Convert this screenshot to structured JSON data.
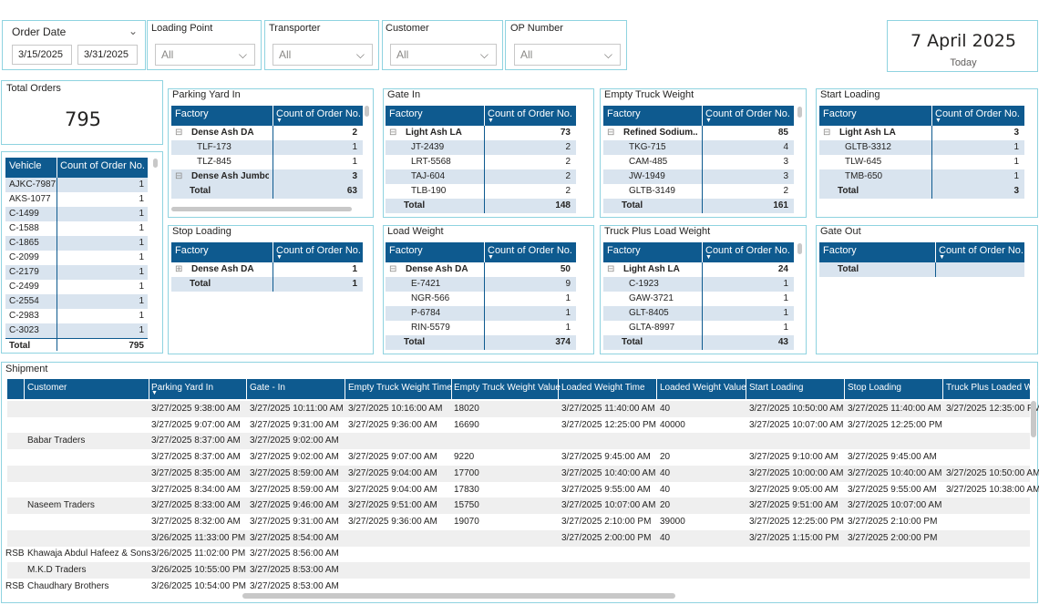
{
  "filters": {
    "order_date": {
      "label": "Order Date",
      "from": "3/15/2025",
      "to": "3/31/2025"
    },
    "loading_point": {
      "label": "Loading Point",
      "value": "All"
    },
    "transporter": {
      "label": "Transporter",
      "value": "All"
    },
    "customer": {
      "label": "Customer",
      "value": "All"
    },
    "op_number": {
      "label": "OP Number",
      "value": "All"
    }
  },
  "today": {
    "date": "7 April 2025",
    "label": "Today"
  },
  "total_orders": {
    "label": "Total Orders",
    "value": "795"
  },
  "vehicle_table": {
    "headers": [
      "Vehicle",
      "Count of Order No."
    ],
    "rows": [
      [
        "AJKC-7987",
        "1"
      ],
      [
        "AKS-1077",
        "1"
      ],
      [
        "C-1499",
        "1"
      ],
      [
        "C-1588",
        "1"
      ],
      [
        "C-1865",
        "1"
      ],
      [
        "C-2099",
        "1"
      ],
      [
        "C-2179",
        "1"
      ],
      [
        "C-2499",
        "1"
      ],
      [
        "C-2554",
        "1"
      ],
      [
        "C-2983",
        "1"
      ],
      [
        "C-3023",
        "1"
      ]
    ],
    "total": [
      "Total",
      "795"
    ]
  },
  "parking_yard": {
    "title": "Parking Yard In",
    "headers": [
      "Factory",
      "Count of Order No."
    ],
    "rows": [
      [
        "⊟",
        "Dense Ash DA",
        "2"
      ],
      [
        "",
        "TLF-173",
        "1"
      ],
      [
        "",
        "TLZ-845",
        "1"
      ],
      [
        "⊟",
        "Dense Ash Jumbo",
        "3"
      ]
    ],
    "total": [
      "Total",
      "63"
    ]
  },
  "gate_in": {
    "title": "Gate In",
    "headers": [
      "Factory",
      "Count of Order No."
    ],
    "rows": [
      [
        "⊟",
        "Light Ash LA",
        "73"
      ],
      [
        "",
        "JT-2439",
        "2"
      ],
      [
        "",
        "LRT-5568",
        "2"
      ],
      [
        "",
        "TAJ-604",
        "2"
      ],
      [
        "",
        "TLB-190",
        "2"
      ]
    ],
    "total": [
      "Total",
      "148"
    ]
  },
  "empty_truck": {
    "title": "Empty Truck Weight",
    "headers": [
      "Factory",
      "Count of Order No."
    ],
    "rows": [
      [
        "⊟",
        "Refined Sodium...",
        "85"
      ],
      [
        "",
        "TKG-715",
        "4"
      ],
      [
        "",
        "CAM-485",
        "3"
      ],
      [
        "",
        "JW-1949",
        "3"
      ],
      [
        "",
        "GLTB-3149",
        "2"
      ]
    ],
    "total": [
      "Total",
      "161"
    ]
  },
  "start_loading": {
    "title": "Start Loading",
    "headers": [
      "Factory",
      "Count of Order No."
    ],
    "rows": [
      [
        "⊟",
        "Light Ash LA",
        "3"
      ],
      [
        "",
        "GLTB-3312",
        "1"
      ],
      [
        "",
        "TLW-645",
        "1"
      ],
      [
        "",
        "TMB-650",
        "1"
      ]
    ],
    "total": [
      "Total",
      "3"
    ]
  },
  "stop_loading": {
    "title": "Stop Loading",
    "headers": [
      "Factory",
      "Count of Order No."
    ],
    "rows": [
      [
        "⊞",
        "Dense Ash DA",
        "1"
      ]
    ],
    "total": [
      "Total",
      "1"
    ]
  },
  "load_weight": {
    "title": "Load Weight",
    "headers": [
      "Factory",
      "Count of Order No."
    ],
    "rows": [
      [
        "⊟",
        "Dense Ash DA",
        "50"
      ],
      [
        "",
        "E-7421",
        "9"
      ],
      [
        "",
        "NGR-566",
        "1"
      ],
      [
        "",
        "P-6784",
        "1"
      ],
      [
        "",
        "RIN-5579",
        "1"
      ]
    ],
    "total": [
      "Total",
      "374"
    ]
  },
  "truck_plus": {
    "title": "Truck Plus Load Weight",
    "headers": [
      "Factory",
      "Count of Order No."
    ],
    "rows": [
      [
        "⊟",
        "Light Ash LA",
        "24"
      ],
      [
        "",
        "C-1923",
        "1"
      ],
      [
        "",
        "GAW-3721",
        "1"
      ],
      [
        "",
        "GLT-8405",
        "1"
      ],
      [
        "",
        "GLTA-8997",
        "1"
      ]
    ],
    "total": [
      "Total",
      "43"
    ]
  },
  "gate_out": {
    "title": "Gate Out",
    "headers": [
      "Factory",
      "Count of Order No."
    ],
    "rows": [],
    "total": [
      "Total",
      ""
    ]
  },
  "shipment": {
    "title": "Shipment",
    "headers": [
      "Customer",
      "Parking Yard In",
      "Gate - In",
      "Empty Truck Weight Time",
      "Empty Truck Weight Value",
      "Loaded Weight Time",
      "Loaded Weight Value",
      "Start Loading",
      "Stop Loading",
      "Truck Plus Loaded We"
    ],
    "rows": [
      [
        "",
        "",
        "3/27/2025 9:38:00 AM",
        "3/27/2025 10:11:00 AM",
        "3/27/2025 10:16:00 AM",
        "18020",
        "3/27/2025 11:40:00 AM",
        "40",
        "3/27/2025 10:50:00 AM",
        "3/27/2025 11:40:00 AM",
        "3/27/2025 12:35:00 PM"
      ],
      [
        "",
        "",
        "3/27/2025 9:07:00 AM",
        "3/27/2025 9:31:00 AM",
        "3/27/2025 9:36:00 AM",
        "16690",
        "3/27/2025 12:25:00 PM",
        "40000",
        "3/27/2025 10:07:00 AM",
        "3/27/2025 12:25:00 PM",
        ""
      ],
      [
        "",
        "Babar Traders",
        "3/27/2025 8:37:00 AM",
        "3/27/2025 9:02:00 AM",
        "",
        "",
        "",
        "",
        "",
        "",
        ""
      ],
      [
        "",
        "",
        "3/27/2025 8:37:00 AM",
        "3/27/2025 9:02:00 AM",
        "3/27/2025 9:07:00 AM",
        "9220",
        "3/27/2025 9:45:00 AM",
        "20",
        "3/27/2025 9:10:00 AM",
        "3/27/2025 9:45:00 AM",
        ""
      ],
      [
        "",
        "",
        "3/27/2025 8:35:00 AM",
        "3/27/2025 8:59:00 AM",
        "3/27/2025 9:04:00 AM",
        "17700",
        "3/27/2025 10:40:00 AM",
        "40",
        "3/27/2025 10:00:00 AM",
        "3/27/2025 10:40:00 AM",
        "3/27/2025 10:50:00 AM"
      ],
      [
        "",
        "",
        "3/27/2025 8:34:00 AM",
        "3/27/2025 8:59:00 AM",
        "3/27/2025 9:04:00 AM",
        "17830",
        "3/27/2025 9:55:00 AM",
        "40",
        "3/27/2025 9:05:00 AM",
        "3/27/2025 9:55:00 AM",
        "3/27/2025 10:38:00 AM"
      ],
      [
        "",
        "Naseem Traders",
        "3/27/2025 8:33:00 AM",
        "3/27/2025 9:46:00 AM",
        "3/27/2025 9:51:00 AM",
        "15750",
        "3/27/2025 10:07:00 AM",
        "20",
        "3/27/2025 9:51:00 AM",
        "3/27/2025 10:07:00 AM",
        ""
      ],
      [
        "",
        "",
        "3/27/2025 8:32:00 AM",
        "3/27/2025 9:31:00 AM",
        "3/27/2025 9:36:00 AM",
        "19070",
        "3/27/2025 2:10:00 PM",
        "39000",
        "3/27/2025 12:25:00 PM",
        "3/27/2025 2:10:00 PM",
        ""
      ],
      [
        "",
        "",
        "3/26/2025 11:33:00 PM",
        "3/27/2025 8:54:00 AM",
        "",
        "",
        "3/27/2025 2:00:00 PM",
        "40",
        "3/27/2025 1:15:00 PM",
        "3/27/2025 2:00:00 PM",
        ""
      ],
      [
        "RSB",
        "Khawaja Abdul Hafeez & Sons",
        "3/26/2025 11:02:00 PM",
        "3/27/2025 8:56:00 AM",
        "",
        "",
        "",
        "",
        "",
        "",
        ""
      ],
      [
        "",
        "M.K.D Traders",
        "3/26/2025 10:55:00 PM",
        "3/27/2025 8:53:00 AM",
        "",
        "",
        "",
        "",
        "",
        "",
        ""
      ],
      [
        "RSB",
        "Chaudhary Brothers",
        "3/26/2025 10:54:00 PM",
        "3/27/2025 8:53:00 AM",
        "",
        "",
        "",
        "",
        "",
        "",
        ""
      ]
    ]
  }
}
